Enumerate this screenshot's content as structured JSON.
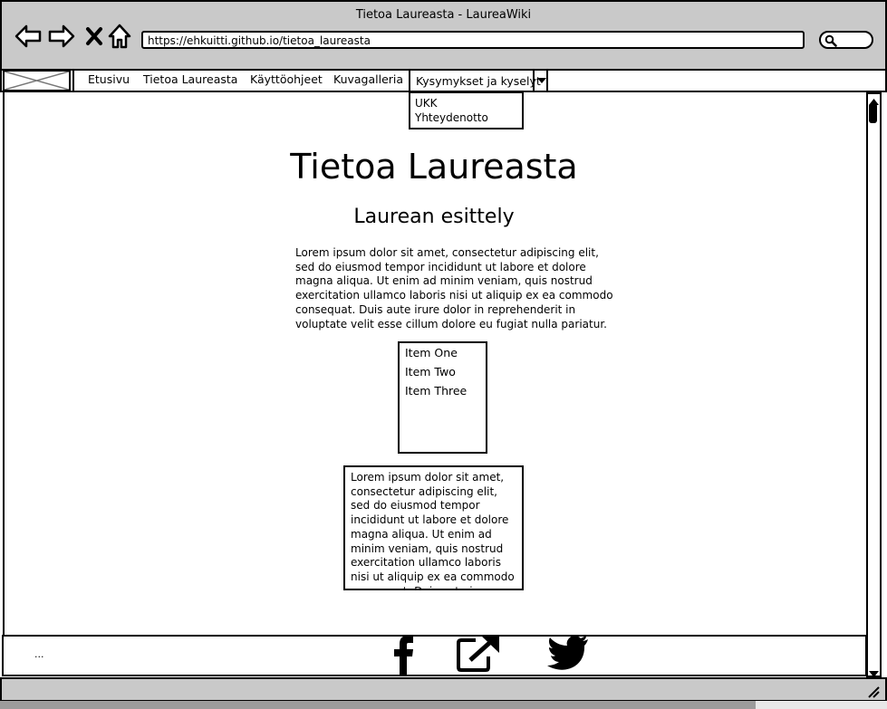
{
  "window": {
    "title": "Tietoa Laureasta - LaureaWiki"
  },
  "browser": {
    "url": "https://ehkuitti.github.io/tietoa_laureasta",
    "icons": [
      "back-arrow-icon",
      "forward-arrow-icon",
      "close-icon",
      "home-icon",
      "search-icon"
    ]
  },
  "nav": {
    "items": [
      "Etusivu",
      "Tietoa Laureasta",
      "Käyttöohjeet",
      "Kuvagalleria"
    ],
    "dropdown": {
      "label": "Kysymykset ja kyselyt",
      "options": [
        "UKK",
        "Yhteydenotto"
      ]
    }
  },
  "main": {
    "title": "Tietoa Laureasta",
    "subtitle": "Laurean esittely",
    "paragraph": "Lorem ipsum dolor sit amet, consectetur adipiscing elit, sed do eiusmod tempor incididunt ut labore et dolore magna aliqua. Ut enim ad minim veniam, quis nostrud exercitation ullamco laboris nisi ut aliquip ex ea commodo consequat. Duis aute irure dolor in reprehenderit in voluptate velit esse cillum dolore eu fugiat nulla pariatur.",
    "list": [
      "Item One",
      "Item Two",
      "Item Three"
    ],
    "textarea": "Lorem ipsum dolor sit amet, consectetur adipiscing elit, sed do eiusmod tempor incididunt ut labore et dolore magna aliqua. Ut enim ad minim veniam, quis nostrud exercitation ullamco laboris nisi ut aliquip ex ea commodo consequat. Duis aute irure"
  },
  "footer": {
    "text": "...",
    "icons": [
      "facebook-icon",
      "external-link-icon",
      "twitter-icon"
    ]
  },
  "colors": {
    "chrome": "#c9c9c9",
    "border": "#000000",
    "background": "#ffffff"
  }
}
